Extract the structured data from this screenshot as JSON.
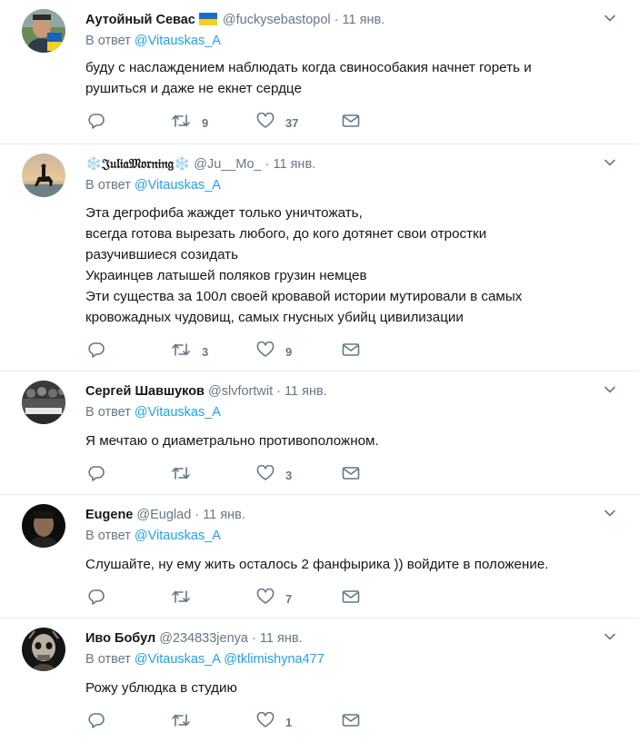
{
  "tweets": [
    {
      "name": "Аутойный Севас",
      "handle": "@fuckysebastopol",
      "dot": "·",
      "time": "11 янв.",
      "reply_prefix": "В ответ",
      "reply_to": "@Vitauskas_A",
      "reply_to2": "",
      "lines": [
        "буду с наслаждением наблюдать когда свинособакия начнет гореть и",
        "рушиться и даже не екнет сердце"
      ],
      "retweets": "9",
      "likes": "37",
      "avatar": "avatar-man-ukraine-flag"
    },
    {
      "name": "𝔍𝔲𝔩𝔦𝔞𝔐𝔬𝔯𝔫𝔦𝔫𝔤",
      "name_prefix": "❄️",
      "name_suffix": "❄️",
      "handle": "@Ju__Mo_",
      "dot": "·",
      "time": "11 янв.",
      "reply_prefix": "В ответ",
      "reply_to": "@Vitauskas_A",
      "reply_to2": "",
      "lines": [
        "Эта дегрофиба жаждет только уничтожать,",
        "всегда готова вырезать любого, до кого дотянет свои отростки",
        "разучившиеся созидать",
        "Украинцев латышей поляков грузин немцев",
        "Эти существа за 100л своей кровавой истории мутировали в самых",
        "кровожадных чудовищ, самых гнусных убийц цивилизации"
      ],
      "retweets": "3",
      "likes": "9",
      "avatar": "avatar-horse-rider-sunset"
    },
    {
      "name": "Сергей Шавшуков",
      "handle": "@slvfortwit",
      "dot": "·",
      "time": "11 янв.",
      "reply_prefix": "В ответ",
      "reply_to": "@Vitauskas_A",
      "reply_to2": "",
      "lines": [
        "Я мечтаю о диаметрально противоположном."
      ],
      "retweets": "",
      "likes": "3",
      "avatar": "avatar-crowd-banner"
    },
    {
      "name": "Eugene",
      "handle": "@Euglad",
      "dot": "·",
      "time": "11 янв.",
      "reply_prefix": "В ответ",
      "reply_to": "@Vitauskas_A",
      "reply_to2": "",
      "lines": [
        "Слушайте, ну ему жить осталось 2 фанфырика )) войдите в положение."
      ],
      "retweets": "",
      "likes": "7",
      "avatar": "avatar-man-dark"
    },
    {
      "name": "Иво Бобул",
      "handle": "@234833jenya",
      "dot": "·",
      "time": "11 янв.",
      "reply_prefix": "В ответ",
      "reply_to": "@Vitauskas_A",
      "reply_to2": "@tklimishyna477",
      "lines": [
        "Рожу ублюдка в студию"
      ],
      "retweets": "",
      "likes": "1",
      "avatar": "avatar-skull-robot"
    }
  ],
  "icons": {
    "reply": "reply-icon",
    "retweet": "retweet-icon",
    "like": "heart-icon",
    "dm": "envelope-icon",
    "caret": "chevron-down-icon"
  },
  "colors": {
    "link": "#1da1f2",
    "muted": "#657786",
    "text": "#14171a",
    "divider": "#e6ecf0"
  }
}
